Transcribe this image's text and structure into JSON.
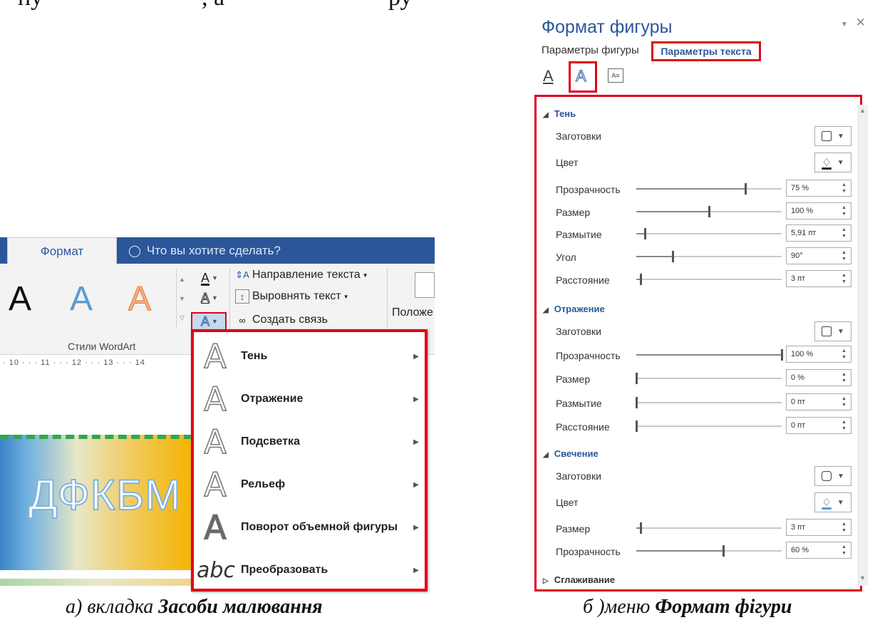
{
  "document": {
    "top_text_left": "ну",
    "top_text_mid": ", а",
    "top_text_right": "ру",
    "caption_left_prefix": "а) вкладка ",
    "caption_left_bold": "Засоби малювання",
    "caption_right_prefix": "б )меню ",
    "caption_right_bold": "Формат фігури"
  },
  "ribbon": {
    "tab_format": "Формат",
    "tell_me": "Что вы хотите сделать?",
    "wordart_samples": [
      "A",
      "A",
      "A"
    ],
    "wordart_group_label": "Стили WordArt",
    "text_direction": "Направление текста",
    "align_text": "Выровнять текст",
    "create_link": "Создать связь",
    "position_label": "Положе",
    "ruler": "· 10 · · · 11 · · · 12 · · · 13 · · · 14"
  },
  "shape": {
    "text": "ДФКБМ"
  },
  "effects_menu": {
    "items": [
      {
        "label": "Тень",
        "icon": "A"
      },
      {
        "label": "Отражение",
        "icon": "A"
      },
      {
        "label": "Подсветка",
        "icon": "A"
      },
      {
        "label": "Рельеф",
        "icon": "A"
      },
      {
        "label": "Поворот объемной фигуры",
        "icon": "A"
      },
      {
        "label": "Преобразовать",
        "icon": "abc"
      }
    ]
  },
  "panel": {
    "title": "Формат фигуры",
    "tab_shape": "Параметры фигуры",
    "tab_text": "Параметры текста",
    "sections": {
      "shadow": {
        "title": "Тень",
        "presets": "Заготовки",
        "color": "Цвет",
        "transparency": "Прозрачность",
        "transparency_value": "75 %",
        "transparency_level": 0.75,
        "size": "Размер",
        "size_value": "100 %",
        "size_level": 0.5,
        "blur": "Размытие",
        "blur_value": "5,91 пт",
        "blur_level": 0.06,
        "angle": "Угол",
        "angle_value": "90°",
        "angle_level": 0.25,
        "distance": "Расстояние",
        "distance_value": "3 пт",
        "distance_level": 0.03
      },
      "reflection": {
        "title": "Отражение",
        "presets": "Заготовки",
        "transparency": "Прозрачность",
        "transparency_value": "100 %",
        "transparency_level": 1.0,
        "size": "Размер",
        "size_value": "0 %",
        "size_level": 0.0,
        "blur": "Размытие",
        "blur_value": "0 пт",
        "blur_level": 0.0,
        "distance": "Расстояние",
        "distance_value": "0 пт",
        "distance_level": 0.0
      },
      "glow": {
        "title": "Свечение",
        "presets": "Заготовки",
        "color": "Цвет",
        "size": "Размер",
        "size_value": "3 пт",
        "size_level": 0.03,
        "transparency": "Прозрачность",
        "transparency_value": "60 %",
        "transparency_level": 0.6
      },
      "smoothing": {
        "title": "Сглаживание"
      }
    }
  },
  "colors": {
    "accent_blue": "#2b579a",
    "highlight_red": "#e0001b"
  }
}
